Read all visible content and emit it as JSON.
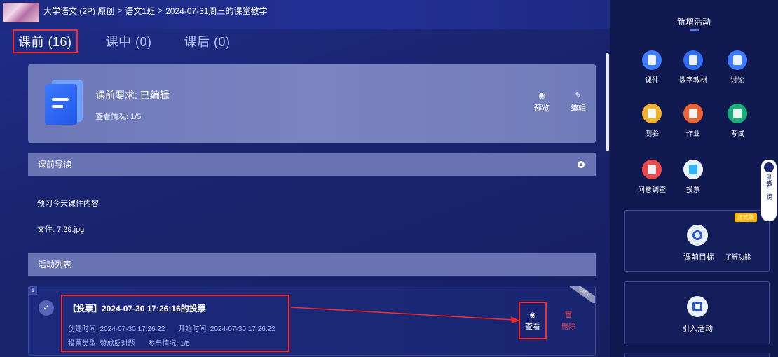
{
  "header": {
    "breadcrumb": [
      "大学语文 (2P) 原创",
      "语文1班",
      "2024-07-31周三的课堂教学"
    ],
    "separator": ">"
  },
  "tabs": [
    {
      "label": "课前 (16)",
      "active": true
    },
    {
      "label": "课中 (0)",
      "active": false
    },
    {
      "label": "课后 (0)",
      "active": false
    }
  ],
  "requirement": {
    "title": "课前要求: 已编辑",
    "view_status": "查看情况:  1/5",
    "preview_label": "预览",
    "edit_label": "编辑"
  },
  "guide": {
    "section_label": "课前导读",
    "content": "预习今天课件内容",
    "file": "文件:  7.29.jpg"
  },
  "activities": {
    "section_label": "活动列表",
    "items": [
      {
        "index": "1",
        "title": "【投票】2024-07-30 17:26:16的投票",
        "created": "创建时间: 2024-07-30 17:26:22",
        "started": "开始时间: 2024-07-30 17:26:22",
        "type": "投票类型: 赞成反对题",
        "participation": "参与情况: 1/5",
        "ribbon": "已结束",
        "view_label": "查看",
        "delete_label": "删除"
      }
    ]
  },
  "sidebar": {
    "title": "新增活动",
    "tools": [
      {
        "label": "课件",
        "color": "#3d7bff",
        "icon": "courseware-icon"
      },
      {
        "label": "数字教材",
        "color": "#2f6df5",
        "icon": "digital-textbook-icon"
      },
      {
        "label": "讨论",
        "color": "#3d7bff",
        "icon": "discussion-icon"
      },
      {
        "label": "测验",
        "color": "#f2b12a",
        "icon": "quiz-icon"
      },
      {
        "label": "作业",
        "color": "#f0622f",
        "icon": "homework-icon"
      },
      {
        "label": "考试",
        "color": "#18b07a",
        "icon": "exam-icon"
      },
      {
        "label": "问卷调查",
        "color": "#f04848",
        "icon": "survey-icon"
      },
      {
        "label": "投票",
        "color": "#e8f2ff",
        "icon": "vote-icon"
      }
    ],
    "goal_label": "课前目标",
    "goal_link": "了解功能",
    "official_badge": "正式版",
    "import_label": "引入活动",
    "assistant_label": "助教一键"
  }
}
